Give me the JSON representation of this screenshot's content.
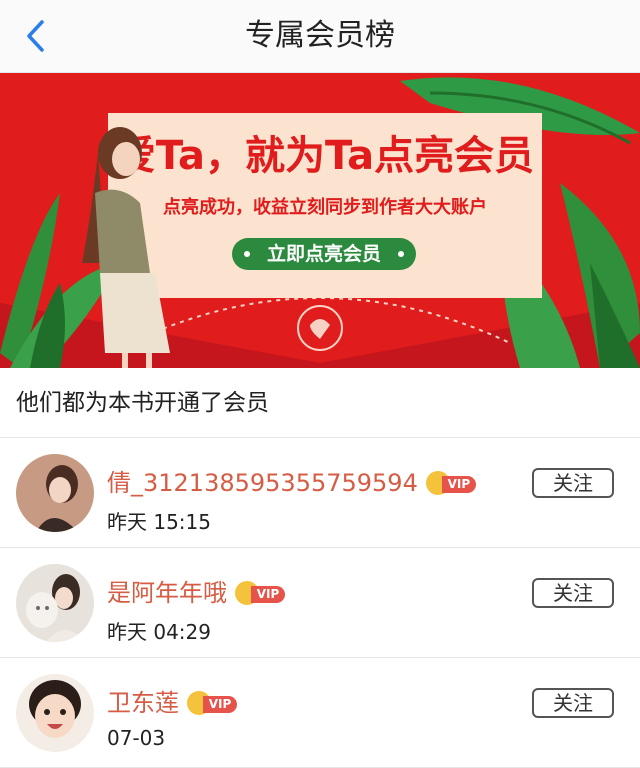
{
  "header": {
    "title": "专属会员榜",
    "back_icon": "chevron-left-icon"
  },
  "banner": {
    "title": "爱Ta，就为Ta点亮会员",
    "subtitle": "点亮成功，收益立刻同步到作者大大账户",
    "button_label": "立即点亮会员",
    "colors": {
      "background": "#e01c1c",
      "card": "#fce3cf",
      "button": "#2c8a3e"
    }
  },
  "section": {
    "title": "他们都为本书开通了会员"
  },
  "members": [
    {
      "name": "倩_312138595355759594",
      "badge": "VIP",
      "time": "昨天 15:15",
      "follow_label": "关注"
    },
    {
      "name": "是阿年年哦",
      "badge": "VIP",
      "time": "昨天 04:29",
      "follow_label": "关注"
    },
    {
      "name": "卫东莲",
      "badge": "VIP",
      "time": "07-03",
      "follow_label": "关注"
    }
  ],
  "colors": {
    "name": "#d65c44",
    "vip_tag": "#e6534a",
    "crown": "#f5c23c"
  }
}
